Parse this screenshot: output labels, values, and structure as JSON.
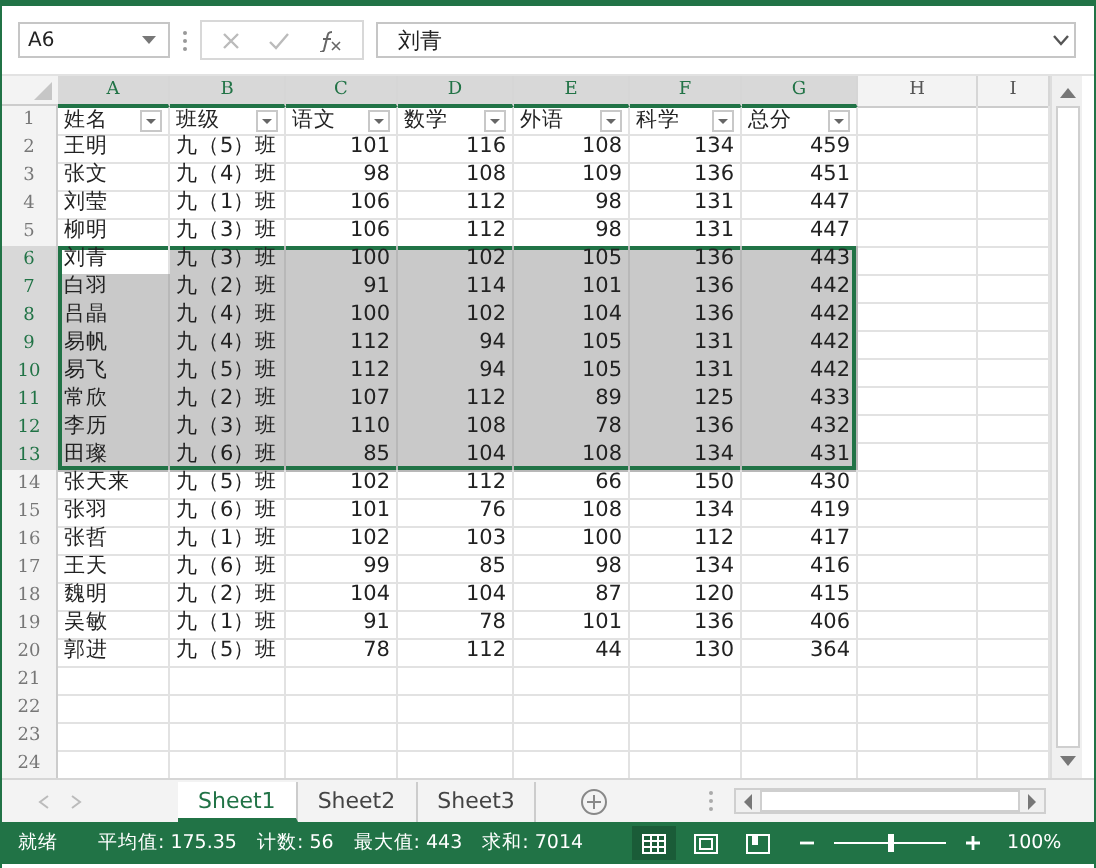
{
  "formula_bar": {
    "name_box": "A6",
    "formula": "刘青"
  },
  "columns": [
    {
      "letter": "A",
      "selected": true
    },
    {
      "letter": "B",
      "selected": true
    },
    {
      "letter": "C",
      "selected": true
    },
    {
      "letter": "D",
      "selected": true
    },
    {
      "letter": "E",
      "selected": true
    },
    {
      "letter": "F",
      "selected": true
    },
    {
      "letter": "G",
      "selected": true
    },
    {
      "letter": "H",
      "selected": false
    },
    {
      "letter": "I",
      "selected": false
    }
  ],
  "header_row": {
    "number": "1",
    "cells": [
      "姓名",
      "班级",
      "语文",
      "数学",
      "外语",
      "科学",
      "总分"
    ]
  },
  "rows": [
    {
      "number": "2",
      "selected": false,
      "active": false,
      "cells": [
        "王明",
        "九（5）班",
        "101",
        "116",
        "108",
        "134",
        "459"
      ]
    },
    {
      "number": "3",
      "selected": false,
      "active": false,
      "cells": [
        "张文",
        "九（4）班",
        "98",
        "108",
        "109",
        "136",
        "451"
      ]
    },
    {
      "number": "4",
      "selected": false,
      "active": false,
      "cells": [
        "刘莹",
        "九（1）班",
        "106",
        "112",
        "98",
        "131",
        "447"
      ]
    },
    {
      "number": "5",
      "selected": false,
      "active": false,
      "cells": [
        "柳明",
        "九（3）班",
        "106",
        "112",
        "98",
        "131",
        "447"
      ]
    },
    {
      "number": "6",
      "selected": true,
      "active": true,
      "cells": [
        "刘青",
        "九（3）班",
        "100",
        "102",
        "105",
        "136",
        "443"
      ]
    },
    {
      "number": "7",
      "selected": true,
      "active": false,
      "cells": [
        "白羽",
        "九（2）班",
        "91",
        "114",
        "101",
        "136",
        "442"
      ]
    },
    {
      "number": "8",
      "selected": true,
      "active": false,
      "cells": [
        "吕晶",
        "九（4）班",
        "100",
        "102",
        "104",
        "136",
        "442"
      ]
    },
    {
      "number": "9",
      "selected": true,
      "active": false,
      "cells": [
        "易帆",
        "九（4）班",
        "112",
        "94",
        "105",
        "131",
        "442"
      ]
    },
    {
      "number": "10",
      "selected": true,
      "active": false,
      "cells": [
        "易飞",
        "九（5）班",
        "112",
        "94",
        "105",
        "131",
        "442"
      ]
    },
    {
      "number": "11",
      "selected": true,
      "active": false,
      "cells": [
        "常欣",
        "九（2）班",
        "107",
        "112",
        "89",
        "125",
        "433"
      ]
    },
    {
      "number": "12",
      "selected": true,
      "active": false,
      "cells": [
        "李历",
        "九（3）班",
        "110",
        "108",
        "78",
        "136",
        "432"
      ]
    },
    {
      "number": "13",
      "selected": true,
      "active": false,
      "cells": [
        "田璨",
        "九（6）班",
        "85",
        "104",
        "108",
        "134",
        "431"
      ]
    },
    {
      "number": "14",
      "selected": false,
      "active": false,
      "cells": [
        "张天来",
        "九（5）班",
        "102",
        "112",
        "66",
        "150",
        "430"
      ]
    },
    {
      "number": "15",
      "selected": false,
      "active": false,
      "cells": [
        "张羽",
        "九（6）班",
        "101",
        "76",
        "108",
        "134",
        "419"
      ]
    },
    {
      "number": "16",
      "selected": false,
      "active": false,
      "cells": [
        "张哲",
        "九（1）班",
        "102",
        "103",
        "100",
        "112",
        "417"
      ]
    },
    {
      "number": "17",
      "selected": false,
      "active": false,
      "cells": [
        "王天",
        "九（6）班",
        "99",
        "85",
        "98",
        "134",
        "416"
      ]
    },
    {
      "number": "18",
      "selected": false,
      "active": false,
      "cells": [
        "魏明",
        "九（2）班",
        "104",
        "104",
        "87",
        "120",
        "415"
      ]
    },
    {
      "number": "19",
      "selected": false,
      "active": false,
      "cells": [
        "吴敏",
        "九（1）班",
        "91",
        "78",
        "101",
        "136",
        "406"
      ]
    },
    {
      "number": "20",
      "selected": false,
      "active": false,
      "cells": [
        "郭进",
        "九（5）班",
        "78",
        "112",
        "44",
        "130",
        "364"
      ]
    },
    {
      "number": "21",
      "selected": false,
      "active": false
    },
    {
      "number": "22",
      "selected": false,
      "active": false
    },
    {
      "number": "23",
      "selected": false,
      "active": false
    },
    {
      "number": "24",
      "selected": false,
      "active": false
    }
  ],
  "sheet_tabs": [
    {
      "label": "Sheet1",
      "selected": true
    },
    {
      "label": "Sheet2",
      "selected": false
    },
    {
      "label": "Sheet3",
      "selected": false
    }
  ],
  "status_bar": {
    "mode": "就绪",
    "stats": [
      "平均值: 175.35",
      "计数: 56",
      "最大值: 443",
      "求和: 7014"
    ],
    "views": [
      {
        "kind": "normal",
        "selected": true
      },
      {
        "kind": "page_layout",
        "selected": false
      },
      {
        "kind": "page_break",
        "selected": false
      }
    ],
    "zoom": {
      "level": 0.5,
      "reading": "100%"
    }
  }
}
